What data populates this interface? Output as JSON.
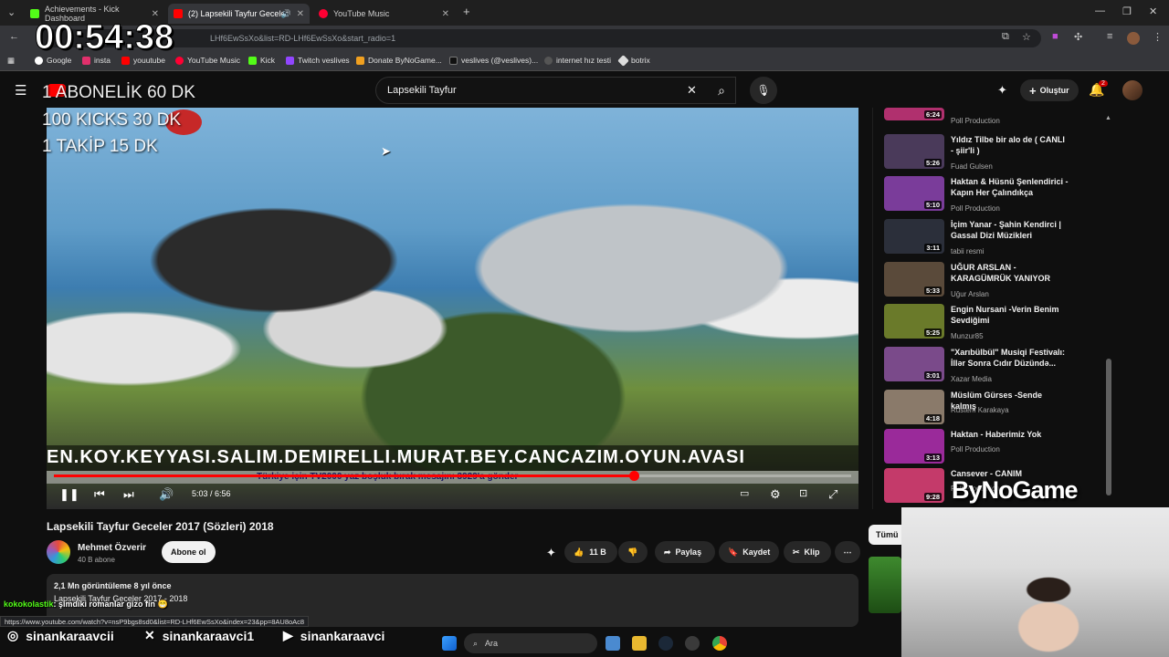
{
  "browser": {
    "tabs": [
      {
        "label": "Achievements - Kick Dashboard",
        "color": "#53fc18"
      },
      {
        "label": "(2) Lapsekili Tayfur Geceler",
        "color": "#ff0000"
      },
      {
        "label": "YouTube Music",
        "color": "#ff0033"
      }
    ],
    "url_visible": "LHf6EwSsXo&list=RD-LHf6EwSsXo&start_radio=1",
    "bookmarks": [
      "Google",
      "insta",
      "youutube",
      "YouTube Music",
      "Kick",
      "Twitch veslives",
      "Donate ByNoGame...",
      "veslives (@veslives)...",
      "internet hız testi",
      "botrix"
    ]
  },
  "youtube": {
    "search_value": "Lapsekili Tayfur",
    "create_label": "Oluştur",
    "notif_count": "2"
  },
  "stream_overlay": {
    "timer": "00:54:38",
    "lines": [
      "1 ABONELİK 60 DK",
      "100 KICKS 30 DK",
      "1 TAKİP 15 DK"
    ],
    "sponsor": "ByNoGame"
  },
  "player": {
    "ticker": "EN.KOY.KEYYASI.SALIM.DEMIRELLI.MURAT.BEY.CANCAZIM.OYUN.AVASI",
    "ticker2": "Türkiye için TV2000 yaz boşluk bırak mesajını 3929'a gönder",
    "time": "5:03 / 6:56",
    "progress": 0.727
  },
  "video": {
    "title": "Lapsekili Tayfur Geceler 2017 (Sözleri) 2018",
    "channel": "Mehmet Özverir",
    "subs": "40 B abone",
    "subscribe_label": "Abone ol",
    "likes": "11 B",
    "share_label": "Paylaş",
    "save_label": "Kaydet",
    "clip_label": "Klip",
    "views_line": "2,1 Mn görüntüleme  8 yıl önce",
    "desc_line": "Lapsekili Tayfur Geceler 2017 - 2018"
  },
  "related": [
    {
      "title": "",
      "channel": "Poll Production",
      "duration": "6:24",
      "color": "#b0306e"
    },
    {
      "title": "Yıldız Tilbe bir alo de ( CANLI - şiir'li )",
      "channel": "Fuad Gulsen",
      "duration": "5:26",
      "color": "#4a3a5a"
    },
    {
      "title": "Haktan & Hüsnü Şenlendirici - Kapın Her Çalındıkça",
      "channel": "Poll Production",
      "duration": "5:10",
      "color": "#7a3c9a"
    },
    {
      "title": "İçim Yanar - Şahin Kendirci | Gassal Dizi Müzikleri",
      "channel": "tabii resmi",
      "duration": "3:11",
      "color": "#2b2f3a"
    },
    {
      "title": "UĞUR ARSLAN - KARAGÜMRÜK YANIYOR",
      "channel": "Uğur Arslan",
      "duration": "5:33",
      "color": "#5a4a3a"
    },
    {
      "title": "Engin Nursani -Verin Benim Sevdiğimi",
      "channel": "Munzur85",
      "duration": "5:25",
      "color": "#6a7a2a"
    },
    {
      "title": "\"Xarıbülbül\" Musiqi Festivalı: İllər Sonra Cıdır Düzündə...",
      "channel": "Xazar Media",
      "duration": "3:01",
      "color": "#7a4a8a"
    },
    {
      "title": "Müslüm Gürses -Sende kalmış",
      "channel": "Rüstem Karakaya",
      "duration": "4:18",
      "color": "#8a7a6a"
    },
    {
      "title": "Haktan - Haberimiz Yok",
      "channel": "Poll Production",
      "duration": "3:13",
      "color": "#9a2a9a"
    },
    {
      "title": "Cansever - CANIM",
      "channel": "Poll Production",
      "duration": "9:28",
      "color": "#c43a6a"
    }
  ],
  "chip_all": "Tümü",
  "chat": {
    "user": "kokokolastik",
    "message": ": şimdiki romanlar gizo fin 😁"
  },
  "status_url": "https://www.youtube.com/watch?v=nsP9bgs8sd0&list=RD-LHf6EwSsXo&index=23&pp=8AU8oAc8",
  "socials": [
    {
      "icon": "instagram-icon",
      "handle": "sinankaraavcii"
    },
    {
      "icon": "x-icon",
      "handle": "sinankaraavci1"
    },
    {
      "icon": "youtube-icon",
      "handle": "sinankaraavci"
    }
  ],
  "taskbar": {
    "search_placeholder": "Ara"
  }
}
